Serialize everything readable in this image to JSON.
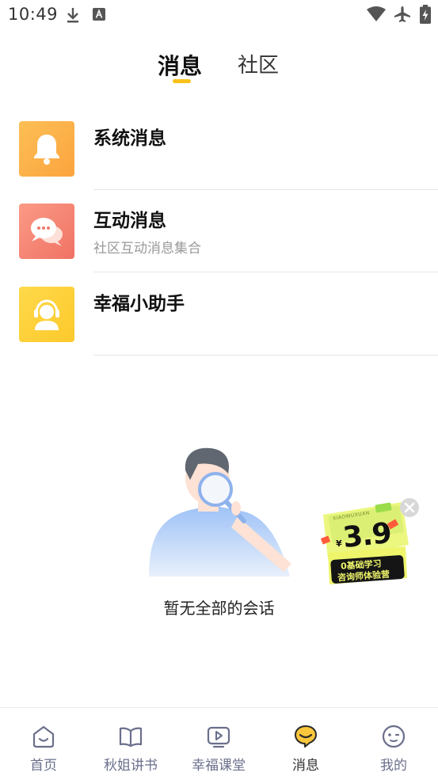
{
  "status_bar": {
    "time": "10:49"
  },
  "tabs": [
    {
      "label": "消息",
      "active": true
    },
    {
      "label": "社区",
      "active": false
    }
  ],
  "messages": [
    {
      "title": "系统消息",
      "subtitle": "",
      "icon": "bell-icon",
      "color": "#fdb44b"
    },
    {
      "title": "互动消息",
      "subtitle": "社区互动消息集合",
      "icon": "chat-bubbles-icon",
      "color": "#f58875"
    },
    {
      "title": "幸福小助手",
      "subtitle": "",
      "icon": "headset-agent-icon",
      "color": "#fdd23c"
    }
  ],
  "empty_state": {
    "text": "暂无全部的会话"
  },
  "promo": {
    "price_currency": "¥",
    "price": "3.9",
    "line1": "0基础学习",
    "line2": "咨询师体验营",
    "brand": "XIAOWUXUAN"
  },
  "bottom_nav": [
    {
      "label": "首页",
      "icon": "home-smile-icon",
      "active": false
    },
    {
      "label": "秋姐讲书",
      "icon": "book-icon",
      "active": false
    },
    {
      "label": "幸福课堂",
      "icon": "video-play-icon",
      "active": false
    },
    {
      "label": "消息",
      "icon": "message-icon",
      "active": true
    },
    {
      "label": "我的",
      "icon": "profile-face-icon",
      "active": false
    }
  ],
  "colors": {
    "accent": "#f9c21a",
    "nav_inactive": "#6a6f8c"
  }
}
